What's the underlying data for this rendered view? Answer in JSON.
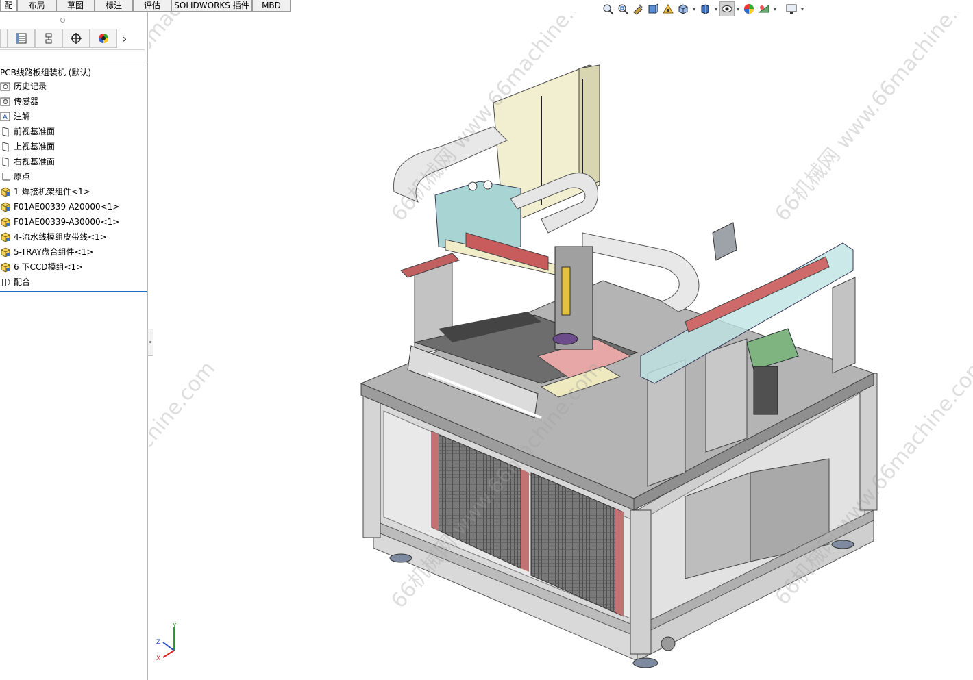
{
  "tabs": [
    {
      "label": "配体",
      "active": true
    },
    {
      "label": "布局",
      "active": false
    },
    {
      "label": "草图",
      "active": false
    },
    {
      "label": "标注",
      "active": false
    },
    {
      "label": "评估",
      "active": false
    },
    {
      "label": "SOLIDWORKS 插件",
      "active": false
    },
    {
      "label": "MBD",
      "active": false
    }
  ],
  "panel_tabs": [
    "feature-manager",
    "property-manager",
    "configuration-manager",
    "dimxpert-manager",
    "display-manager"
  ],
  "tree": {
    "root": "PCB线路板组装机  (默认)",
    "items": [
      {
        "label": "历史记录",
        "icon": "history-icon"
      },
      {
        "label": "传感器",
        "icon": "sensor-icon"
      },
      {
        "label": "注解",
        "icon": "annotation-icon"
      },
      {
        "label": "前视基准面",
        "icon": "plane-icon"
      },
      {
        "label": "上视基准面",
        "icon": "plane-icon"
      },
      {
        "label": "右视基准面",
        "icon": "plane-icon"
      },
      {
        "label": "原点",
        "icon": "origin-icon"
      },
      {
        "label": "1-焊接机架组件<1>",
        "icon": "assembly-icon"
      },
      {
        "label": "F01AE00339-A20000<1>",
        "icon": "assembly-icon"
      },
      {
        "label": "F01AE00339-A30000<1>",
        "icon": "assembly-icon"
      },
      {
        "label": "4-流水线模组皮带线<1>",
        "icon": "assembly-icon"
      },
      {
        "label": "5-TRAY盘合组件<1>",
        "icon": "assembly-icon"
      },
      {
        "label": "6 下CCD模组<1>",
        "icon": "assembly-icon"
      },
      {
        "label": "配合",
        "icon": "mates-icon"
      }
    ]
  },
  "hud": [
    "zoom-to-fit-icon",
    "zoom-area-icon",
    "previous-view-icon",
    "section-view-icon",
    "dynamic-annotation-icon",
    "view-orientation-icon",
    "display-style-icon",
    "hide-show-icon",
    "edit-appearance-icon",
    "apply-scene-icon",
    "view-settings-icon"
  ],
  "watermark": "66机械网 www.66machine.com",
  "triad": {
    "x": "X",
    "y": "Y",
    "z": "Z"
  },
  "colors": {
    "selection": "#1b6fc9",
    "frame": "#c8c8c8",
    "panel": "#ffffff"
  }
}
